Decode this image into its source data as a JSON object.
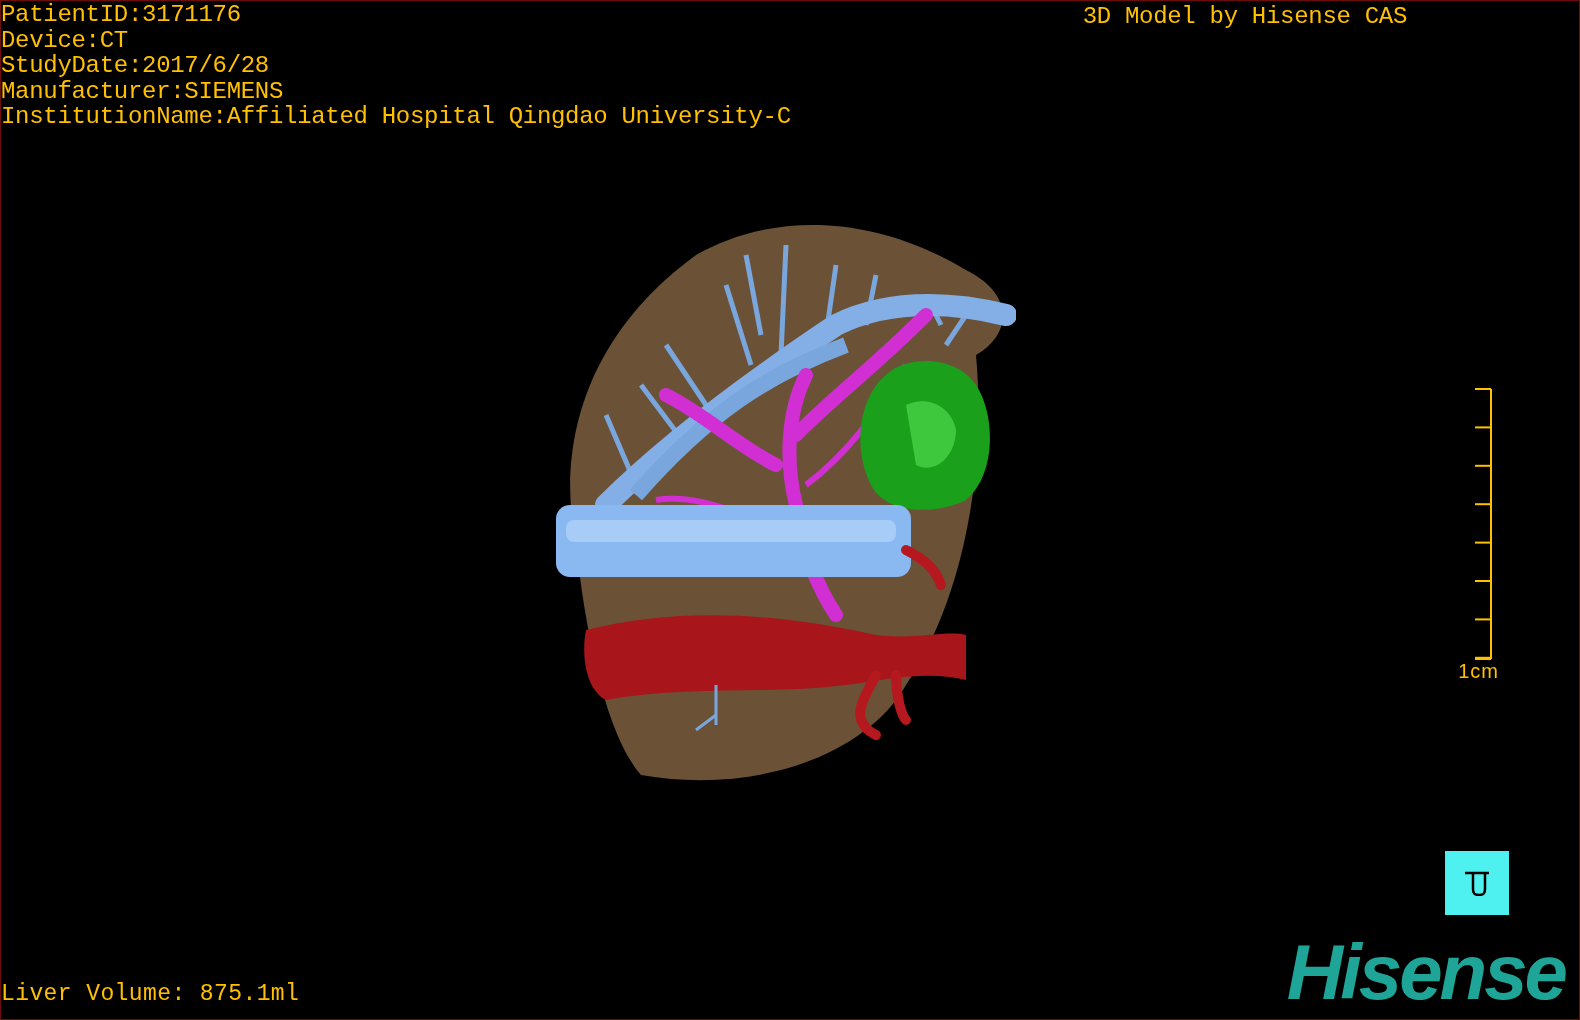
{
  "info_lines": [
    "PatientID:3171176",
    "Device:CT",
    "StudyDate:2017/6/28",
    "Manufacturer:SIEMENS",
    "InstitutionName:Affiliated Hospital Qingdao University-C"
  ],
  "title": "3D Model by Hisense CAS",
  "scale": {
    "label": "1cm"
  },
  "liver_volume": "Liver Volume: 875.1ml",
  "logo": "Hisense"
}
